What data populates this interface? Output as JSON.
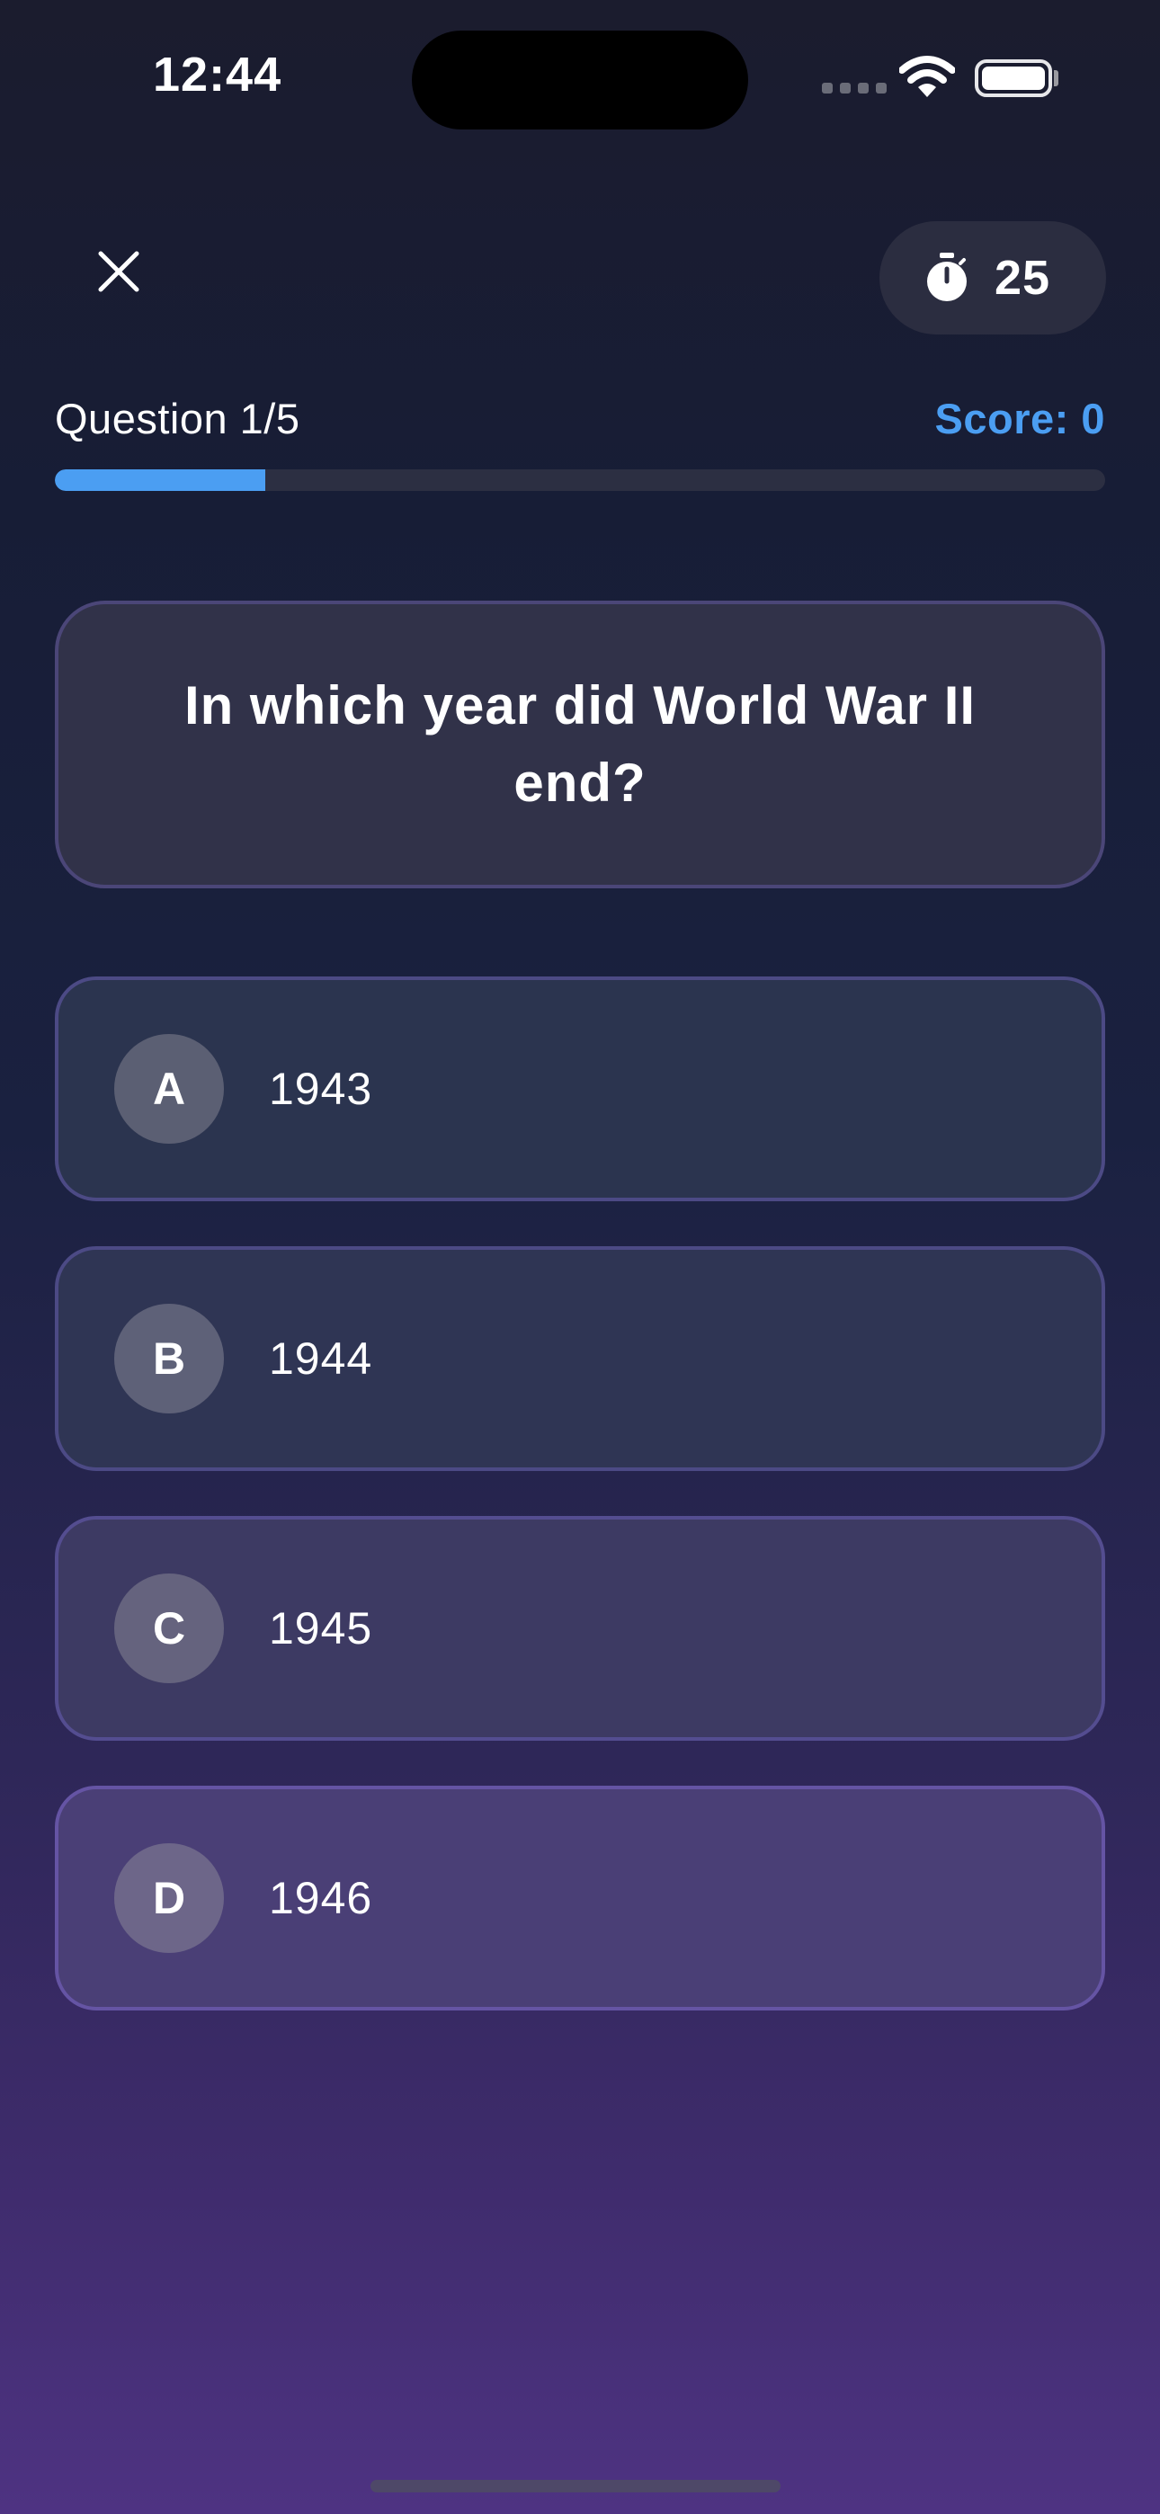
{
  "status_bar": {
    "time": "12:44"
  },
  "header": {
    "timer_value": "25"
  },
  "progress": {
    "question_label": "Question 1/5",
    "score_label": "Score: 0",
    "fraction": 0.2,
    "fill_color": "#4b9ef2"
  },
  "question": {
    "text": "In which year did World War II end?"
  },
  "options": [
    {
      "letter": "A",
      "text": "1943"
    },
    {
      "letter": "B",
      "text": "1944"
    },
    {
      "letter": "C",
      "text": "1945"
    },
    {
      "letter": "D",
      "text": "1946"
    }
  ],
  "icons": {
    "close": "close-icon",
    "timer": "stopwatch-icon",
    "wifi": "wifi-icon",
    "battery": "battery-icon"
  }
}
